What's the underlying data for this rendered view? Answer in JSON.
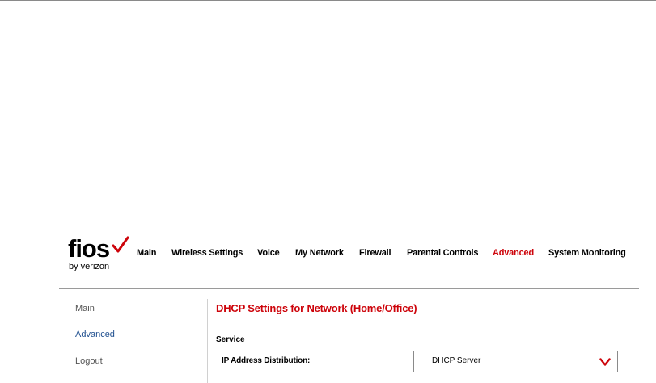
{
  "logo": {
    "word": "fios",
    "tagline": "by verizon"
  },
  "nav": {
    "items": [
      {
        "label": "Main",
        "active": false
      },
      {
        "label": "Wireless Settings",
        "active": false
      },
      {
        "label": "Voice",
        "active": false
      },
      {
        "label": "My Network",
        "active": false
      },
      {
        "label": "Firewall",
        "active": false
      },
      {
        "label": "Parental Controls",
        "active": false
      },
      {
        "label": "Advanced",
        "active": true
      },
      {
        "label": "System Monitoring",
        "active": false
      }
    ]
  },
  "sidebar": {
    "items": [
      {
        "label": "Main",
        "active": false
      },
      {
        "label": "Advanced",
        "active": true
      },
      {
        "label": "Logout",
        "active": false
      }
    ]
  },
  "content": {
    "title": "DHCP Settings for Network (Home/Office)",
    "section": "Service",
    "field_label": "IP Address Distribution:",
    "field_value": "DHCP Server"
  },
  "colors": {
    "accent": "#cd040b",
    "sidebar_active": "#1f4f8f"
  },
  "icons": {
    "logo_mark": "checkmark-icon",
    "select_arrow": "chevron-down-icon"
  }
}
